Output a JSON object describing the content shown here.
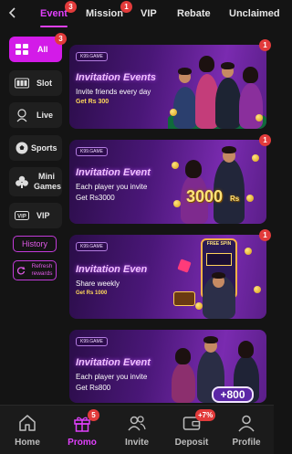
{
  "header": {
    "back_icon": "chevron-left-icon",
    "tabs": [
      {
        "label": "Event",
        "badge": "3",
        "active": true
      },
      {
        "label": "Mission",
        "badge": "1"
      },
      {
        "label": "VIP"
      },
      {
        "label": "Rebate"
      },
      {
        "label": "Unclaimed"
      }
    ]
  },
  "sidebar": {
    "items": [
      {
        "label": "All",
        "icon": "grid-icon",
        "badge": "3",
        "active": true
      },
      {
        "label": "Slot",
        "icon": "slot-machine-icon"
      },
      {
        "label": "Live",
        "icon": "live-dealer-icon"
      },
      {
        "label": "Sports",
        "icon": "soccer-ball-icon"
      },
      {
        "label": "Mini Games",
        "icon": "club-icon"
      },
      {
        "label": "VIP",
        "icon": "vip-icon"
      }
    ],
    "history_label": "History",
    "refresh_label": "Refresh rewards"
  },
  "cards": [
    {
      "logo": "K99.GAME",
      "title": "Invitation Events",
      "subtitle": "Invite friends every day",
      "reward": "Get Rs 300",
      "badge": "1"
    },
    {
      "logo": "K99.GAME",
      "title": "Invitation Event",
      "subtitle": "Each player you invite",
      "reward": "Get Rs3000",
      "badge": "1",
      "art_number": "3000",
      "art_unit": "Rs"
    },
    {
      "logo": "K99.GAME",
      "title": "Invitation Even",
      "subtitle": "Share weekly",
      "reward": "Get Rs 1000",
      "badge": "1",
      "art_sign": "FREE SPIN"
    },
    {
      "logo": "K99.GAME",
      "title": "Invitation Event",
      "subtitle": "Each player you invite",
      "reward": "Get Rs800",
      "badge": "1",
      "art_number": "+800"
    }
  ],
  "bottom_nav": [
    {
      "label": "Home",
      "icon": "home-icon"
    },
    {
      "label": "Promo",
      "icon": "gift-icon",
      "badge": "5",
      "active": true
    },
    {
      "label": "Invite",
      "icon": "users-icon"
    },
    {
      "label": "Deposit",
      "icon": "wallet-icon",
      "badge": "+7%"
    },
    {
      "label": "Profile",
      "icon": "user-icon"
    }
  ],
  "colors": {
    "accent": "#e040fb",
    "active_sidebar": "#d31be8",
    "badge": "#e23b3b",
    "background": "#141414"
  }
}
